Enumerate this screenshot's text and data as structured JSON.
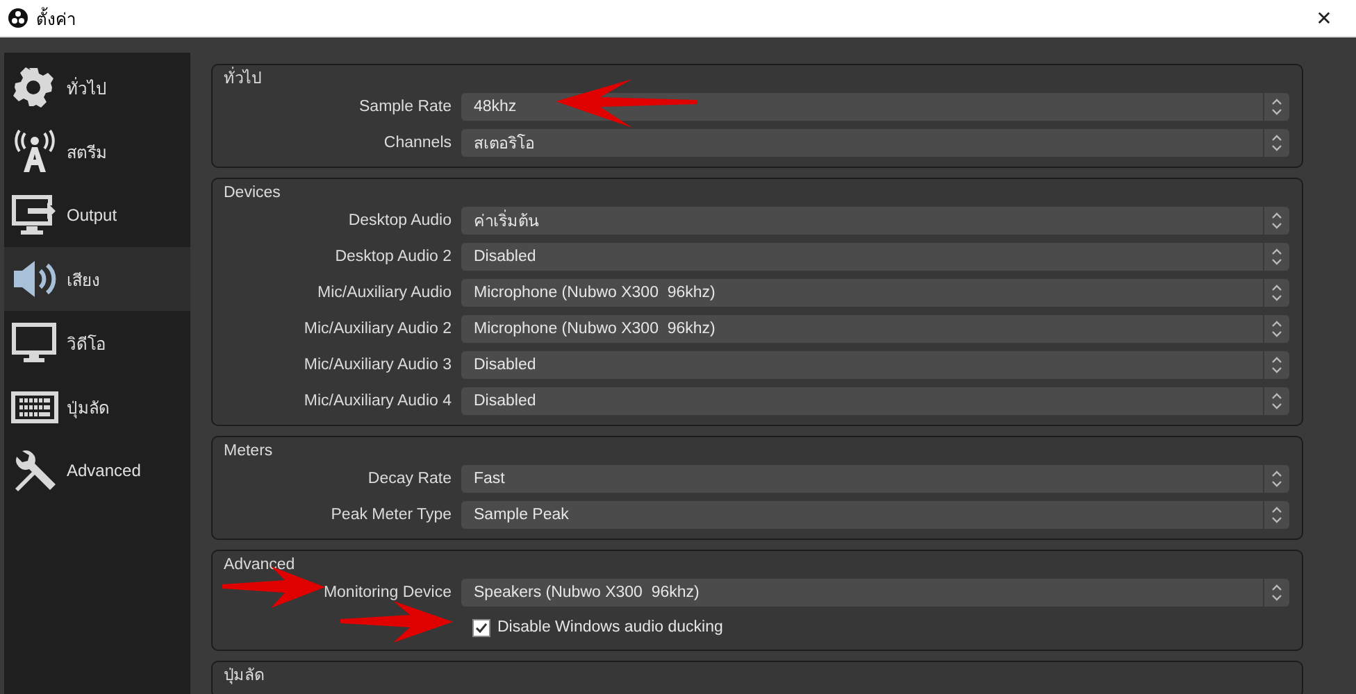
{
  "window": {
    "title": "ตั้งค่า",
    "close": "✕"
  },
  "sidebar": {
    "items": [
      {
        "label": "ทั่วไป",
        "selected": false
      },
      {
        "label": "สตรีม",
        "selected": false
      },
      {
        "label": "Output",
        "selected": false
      },
      {
        "label": "เสียง",
        "selected": true
      },
      {
        "label": "วิดีโอ",
        "selected": false
      },
      {
        "label": "ปุ่มลัด",
        "selected": false
      },
      {
        "label": "Advanced",
        "selected": false
      }
    ]
  },
  "sections": [
    {
      "title": "ทั่วไป",
      "rows": [
        {
          "kind": "combo",
          "label": "Sample Rate",
          "value": "48khz"
        },
        {
          "kind": "combo",
          "label": "Channels",
          "value": "สเตอริโอ"
        }
      ]
    },
    {
      "title": "Devices",
      "rows": [
        {
          "kind": "combo",
          "label": "Desktop Audio",
          "value": "ค่าเริ่มต้น"
        },
        {
          "kind": "combo",
          "label": "Desktop Audio 2",
          "value": "Disabled"
        },
        {
          "kind": "combo",
          "label": "Mic/Auxiliary Audio",
          "value": "Microphone (Nubwo X300  96khz)"
        },
        {
          "kind": "combo",
          "label": "Mic/Auxiliary Audio 2",
          "value": "Microphone (Nubwo X300  96khz)"
        },
        {
          "kind": "combo",
          "label": "Mic/Auxiliary Audio 3",
          "value": "Disabled"
        },
        {
          "kind": "combo",
          "label": "Mic/Auxiliary Audio 4",
          "value": "Disabled"
        }
      ]
    },
    {
      "title": "Meters",
      "rows": [
        {
          "kind": "combo",
          "label": "Decay Rate",
          "value": "Fast"
        },
        {
          "kind": "combo",
          "label": "Peak Meter Type",
          "value": "Sample Peak"
        }
      ]
    },
    {
      "title": "Advanced",
      "rows": [
        {
          "kind": "combo",
          "label": "Monitoring Device",
          "value": "Speakers (Nubwo X300  96khz)"
        },
        {
          "kind": "checkbox",
          "label": "Disable Windows audio ducking",
          "checked": true
        }
      ]
    },
    {
      "title": "ปุ่มลัด"
    }
  ]
}
